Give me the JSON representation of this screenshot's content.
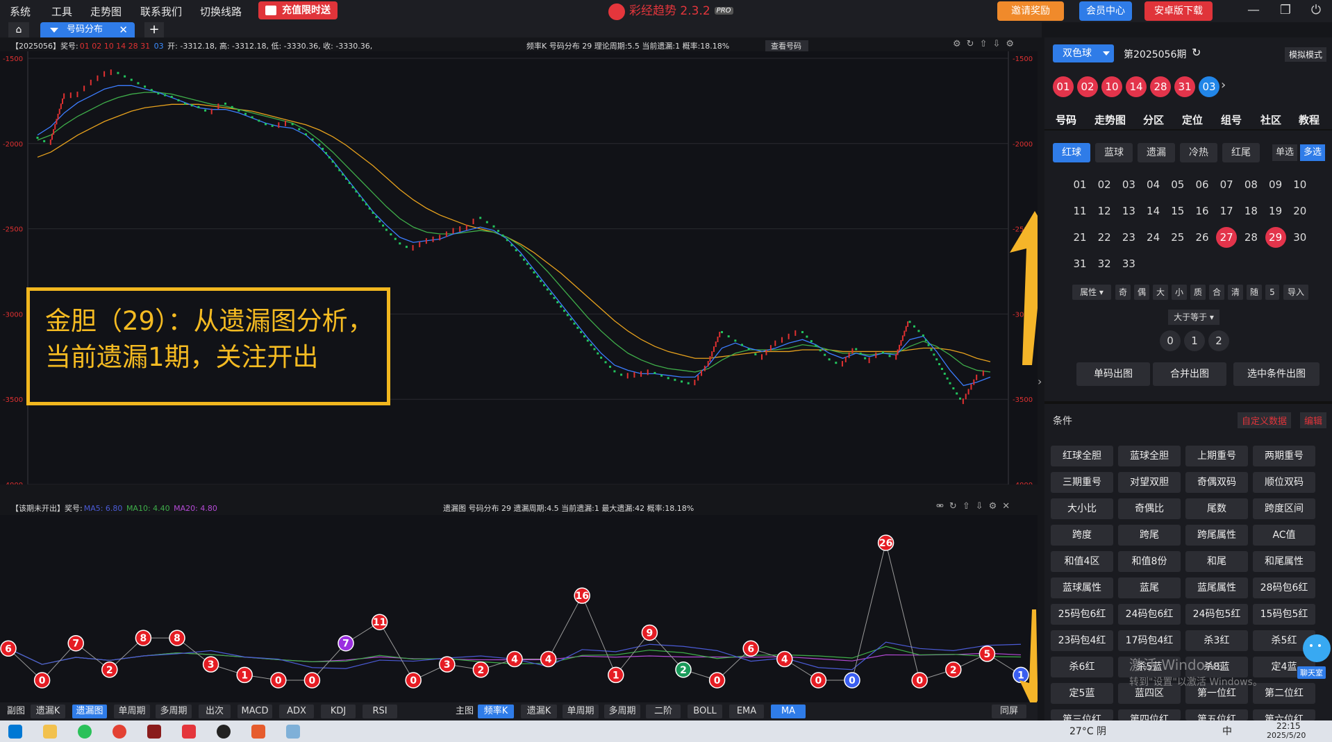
{
  "menu": [
    "系统",
    "工具",
    "走势图",
    "联系我们",
    "切换线路"
  ],
  "promo_label": "充值限时送",
  "app": {
    "title": "彩经趋势 2.3.2",
    "badge": "PRO"
  },
  "top_buttons": {
    "invite": "邀请奖励",
    "member": "会员中心",
    "android": "安卓版下载"
  },
  "tab": {
    "label": "号码分布"
  },
  "main_info": {
    "period": "【2025056】奖号:",
    "red_nums": "01 02 10 14 28 31",
    "blue_num": "03",
    "ohlc": "开: -3312.18, 高: -3312.18, 低: -3330.36, 收: -3330.36,",
    "stats": "频率K  号码分布  29   理论周期:5.5  当前遗漏:1  概率:18.18%",
    "lookup": "查看号码"
  },
  "main_axis": {
    "ticks": [
      "-1500",
      "-2000",
      "-2500",
      "-3000",
      "-3500",
      "-4000"
    ],
    "right_ticks": [
      "-1500",
      "-2000",
      "-250",
      "-30",
      "-3500",
      "-4000"
    ]
  },
  "sub_info": {
    "prefix": "【该期未开出】奖号:",
    "ma5": "MA5: 6.80",
    "ma10": "MA10: 4.40",
    "ma20": "MA20: 4.80",
    "stats": "遗漏图  号码分布  29    遗漏周期:4.5  当前遗漏:1   最大遗漏:42   概率:18.18%"
  },
  "annotation": [
    "金胆（29）：从遗漏图分析，",
    "当前遗漏1期，关注开出"
  ],
  "chart_data": [
    {
      "type": "line",
      "title": "号码分布 29 频率K",
      "ylim": [
        -4000,
        -1500
      ],
      "series": [
        {
          "name": "K",
          "color": "#22c55e",
          "values": [
            -1960,
            -2000,
            -1730,
            -1720,
            -1650,
            -1600,
            -1580,
            -1620,
            -1660,
            -1700,
            -1720,
            -1760,
            -1780,
            -1820,
            -1760,
            -1800,
            -1840,
            -1880,
            -1900,
            -1880,
            -1940,
            -2000,
            -2100,
            -2200,
            -2300,
            -2400,
            -2500,
            -2580,
            -2620,
            -2580,
            -2560,
            -2520,
            -2500,
            -2430,
            -2480,
            -2560,
            -2650,
            -2750,
            -2850,
            -2950,
            -3050,
            -3150,
            -3250,
            -3330,
            -3370,
            -3360,
            -3340,
            -3370,
            -3390,
            -3410,
            -3300,
            -3100,
            -3150,
            -3200,
            -3260,
            -3180,
            -3140,
            -3100,
            -3180,
            -3260,
            -3300,
            -3200,
            -3280,
            -3220,
            -3260,
            -3040,
            -3120,
            -3260,
            -3400,
            -3520,
            -3380,
            -3330
          ]
        },
        {
          "name": "MA5",
          "color": "#3c7dff",
          "values": [
            -1950,
            -1900,
            -1820,
            -1760,
            -1720,
            -1680,
            -1660,
            -1660,
            -1680,
            -1700,
            -1730,
            -1760,
            -1790,
            -1800,
            -1800,
            -1820,
            -1850,
            -1880,
            -1900,
            -1910,
            -1950,
            -2020,
            -2100,
            -2200,
            -2300,
            -2400,
            -2480,
            -2550,
            -2580,
            -2570,
            -2560,
            -2530,
            -2510,
            -2490,
            -2510,
            -2560,
            -2640,
            -2740,
            -2840,
            -2940,
            -3040,
            -3140,
            -3230,
            -3300,
            -3330,
            -3350,
            -3350,
            -3360,
            -3370,
            -3370,
            -3300,
            -3200,
            -3170,
            -3200,
            -3220,
            -3200,
            -3170,
            -3150,
            -3180,
            -3230,
            -3260,
            -3230,
            -3250,
            -3230,
            -3240,
            -3150,
            -3130,
            -3220,
            -3330,
            -3420,
            -3400,
            -3370
          ]
        },
        {
          "name": "MA10",
          "color": "#3fae4a",
          "values": [
            -1980,
            -1950,
            -1890,
            -1840,
            -1800,
            -1760,
            -1730,
            -1710,
            -1700,
            -1700,
            -1710,
            -1730,
            -1750,
            -1770,
            -1780,
            -1800,
            -1820,
            -1840,
            -1860,
            -1880,
            -1920,
            -1980,
            -2050,
            -2130,
            -2210,
            -2290,
            -2370,
            -2440,
            -2490,
            -2520,
            -2530,
            -2530,
            -2520,
            -2510,
            -2520,
            -2550,
            -2600,
            -2670,
            -2750,
            -2840,
            -2930,
            -3020,
            -3100,
            -3170,
            -3230,
            -3270,
            -3300,
            -3320,
            -3330,
            -3340,
            -3320,
            -3270,
            -3230,
            -3210,
            -3210,
            -3210,
            -3200,
            -3180,
            -3190,
            -3210,
            -3230,
            -3230,
            -3240,
            -3230,
            -3230,
            -3190,
            -3160,
            -3190,
            -3240,
            -3300,
            -3330,
            -3340
          ]
        },
        {
          "name": "MA20",
          "color": "#e8a21d",
          "values": [
            -2080,
            -2050,
            -2000,
            -1950,
            -1910,
            -1870,
            -1840,
            -1810,
            -1790,
            -1780,
            -1770,
            -1770,
            -1770,
            -1780,
            -1790,
            -1800,
            -1810,
            -1830,
            -1850,
            -1870,
            -1890,
            -1920,
            -1960,
            -2010,
            -2070,
            -2130,
            -2200,
            -2270,
            -2330,
            -2380,
            -2420,
            -2450,
            -2480,
            -2500,
            -2520,
            -2550,
            -2590,
            -2640,
            -2700,
            -2760,
            -2830,
            -2900,
            -2970,
            -3040,
            -3100,
            -3150,
            -3190,
            -3220,
            -3240,
            -3260,
            -3260,
            -3250,
            -3240,
            -3230,
            -3220,
            -3220,
            -3220,
            -3210,
            -3210,
            -3210,
            -3220,
            -3220,
            -3220,
            -3220,
            -3220,
            -3210,
            -3200,
            -3200,
            -3210,
            -3230,
            -3260,
            -3280
          ]
        }
      ]
    },
    {
      "type": "line",
      "title": "遗漏图 号码分布 29",
      "points": [
        6,
        0,
        7,
        2,
        8,
        8,
        3,
        1,
        0,
        0,
        7,
        11,
        0,
        3,
        2,
        4,
        4,
        16,
        1,
        9,
        2,
        0,
        6,
        4,
        0,
        0,
        26,
        0,
        2,
        5,
        1
      ],
      "point_colors": [
        "red",
        "red",
        "red",
        "red",
        "red",
        "red",
        "red",
        "red",
        "red",
        "red",
        "purple",
        "red",
        "red",
        "red",
        "red",
        "red",
        "red",
        "red",
        "red",
        "red",
        "green",
        "red",
        "red",
        "red",
        "red",
        "blue",
        "red",
        "red",
        "red",
        "red",
        "blue"
      ],
      "series": [
        {
          "name": "MA5",
          "color": "#4b5bd6"
        },
        {
          "name": "MA10",
          "color": "#3fae4a"
        },
        {
          "name": "MA20",
          "color": "#b54ad6"
        }
      ]
    }
  ],
  "bottom_bar": {
    "sub_label": "副图",
    "sub_buttons": [
      "遗漏K",
      "遗漏图",
      "单周期",
      "多周期",
      "出次",
      "MACD",
      "ADX",
      "KDJ",
      "RSI"
    ],
    "main_label": "主图",
    "main_buttons": [
      "频率K",
      "遗漏K",
      "单周期",
      "多周期",
      "二阶",
      "BOLL",
      "EMA",
      "MA"
    ],
    "sync": "同屏"
  },
  "right": {
    "lottery": "双色球",
    "period": "第2025056期",
    "mode": "模拟模式",
    "red_balls": [
      "01",
      "02",
      "10",
      "14",
      "28",
      "31"
    ],
    "blue_ball": "03",
    "nav": [
      "号码",
      "走势图",
      "分区",
      "定位",
      "组号",
      "社区",
      "教程"
    ],
    "ball_tabs": [
      "红球",
      "蓝球",
      "遗漏",
      "冷热",
      "红尾"
    ],
    "single": "单选",
    "multi": "多选",
    "numbers": [
      "01",
      "02",
      "03",
      "04",
      "05",
      "06",
      "07",
      "08",
      "09",
      "10",
      "11",
      "12",
      "13",
      "14",
      "15",
      "16",
      "17",
      "18",
      "19",
      "20",
      "21",
      "22",
      "23",
      "24",
      "25",
      "26",
      "27",
      "28",
      "29",
      "30",
      "31",
      "32",
      "33"
    ],
    "selected": [
      "27",
      "29"
    ],
    "attr_label": "属性",
    "attrs": [
      "奇",
      "偶",
      "大",
      "小",
      "质",
      "合",
      "清",
      "随"
    ],
    "random_count": "5",
    "import": "导入",
    "cmp": "大于等于",
    "cmp_nums": [
      "0",
      "1",
      "2"
    ],
    "actions": [
      "单码出图",
      "合并出图",
      "选中条件出图"
    ],
    "cond_title": "条件",
    "custom": "自定义数据",
    "edit": "编辑",
    "conditions": [
      "红球全胆",
      "蓝球全胆",
      "上期重号",
      "两期重号",
      "三期重号",
      "对望双胆",
      "奇偶双码",
      "顺位双码",
      "大小比",
      "奇偶比",
      "尾数",
      "跨度区间",
      "跨度",
      "跨尾",
      "跨尾属性",
      "AC值",
      "和值4区",
      "和值8份",
      "和尾",
      "和尾属性",
      "蓝球属性",
      "蓝尾",
      "蓝尾属性",
      "28码包6红",
      "25码包6红",
      "24码包6红",
      "24码包5红",
      "15码包5红",
      "23码包4红",
      "17码包4红",
      "杀3红",
      "杀5红",
      "杀6红",
      "杀5蓝",
      "杀8蓝",
      "定4蓝",
      "定5蓝",
      "蓝四区",
      "第一位红",
      "第二位红",
      "第三位红",
      "第四位红",
      "第五位红",
      "第六位红"
    ],
    "chat": "聊天室",
    "watermark1": "激活 Windows",
    "watermark2": "转到\"设置\"以激活 Windows。"
  },
  "taskbar": {
    "weather": "27°C 阴",
    "time": "22:15",
    "date": "2025/5/20",
    "ime": "中"
  }
}
